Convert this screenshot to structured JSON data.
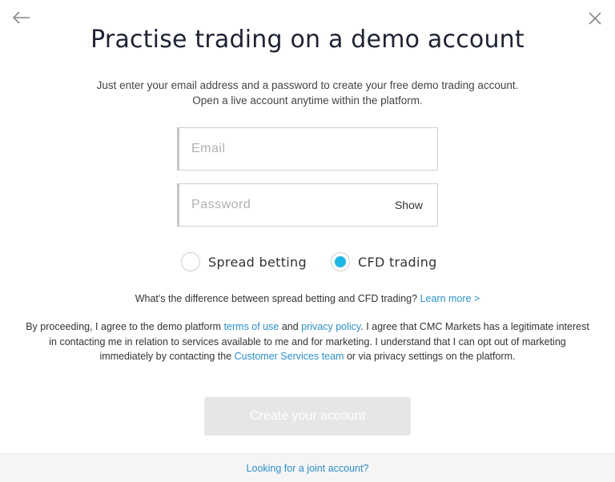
{
  "nav": {
    "back_icon": "arrow-left-icon",
    "close_icon": "close-icon"
  },
  "title": "Practise trading on a demo account",
  "subtitle": "Just enter your email address and a password to create your free demo trading account. Open a live account anytime within the platform.",
  "form": {
    "email": {
      "value": "",
      "placeholder": "Email"
    },
    "password": {
      "value": "",
      "placeholder": "Password",
      "toggle_label": "Show"
    },
    "account_type": {
      "options": [
        {
          "label": "Spread betting",
          "selected": false
        },
        {
          "label": "CFD trading",
          "selected": true
        }
      ]
    }
  },
  "difference": {
    "text": "What's the difference between spread betting and CFD trading?",
    "link": "Learn more >"
  },
  "consent": {
    "part1": "By proceeding, I agree to the demo platform ",
    "terms_link": "terms of use",
    "part2": " and ",
    "privacy_link": "privacy policy",
    "part3": ". I agree that CMC Markets has a legitimate interest in contacting me in relation to services available to me and for marketing. I understand that I can opt out of marketing immediately by contacting the ",
    "customer_services_link": "Customer Services team",
    "part4": " or via privacy settings on the platform."
  },
  "submit_label": "Create your account",
  "footer": {
    "joint_account_link": "Looking for a joint account?"
  },
  "colors": {
    "accent": "#1eb8e8",
    "link": "#2a8fd0",
    "title": "#1e2233",
    "button_disabled": "#e6e6e6"
  }
}
